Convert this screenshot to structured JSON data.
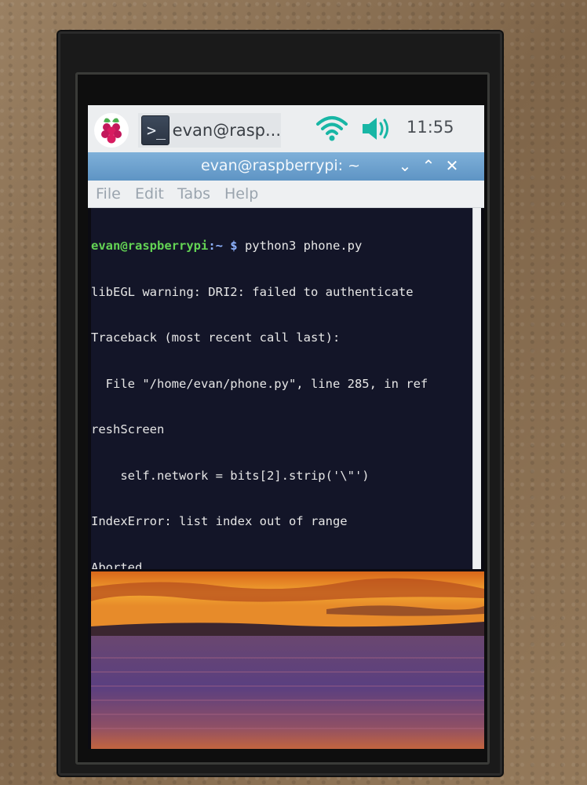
{
  "panel": {
    "task_title": "evan@rasp...",
    "clock": "11:55",
    "menu_icon": "raspberry-pi-logo",
    "network_icon": "wifi-icon",
    "volume_icon": "speaker-icon"
  },
  "window": {
    "title": "evan@raspberrypi: ~",
    "controls": [
      "minimize",
      "maximize",
      "close"
    ]
  },
  "menubar": {
    "file": "File",
    "edit": "Edit",
    "tabs": "Tabs",
    "help": "Help"
  },
  "terminal": {
    "prompt_user": "evan@raspberrypi",
    "prompt_path": ":~ $",
    "command": " python3 phone.py",
    "lines": [
      "libEGL warning: DRI2: failed to authenticate",
      "Traceback (most recent call last):",
      "  File \"/home/evan/phone.py\", line 285, in ref",
      "reshScreen",
      "    self.network = bits[2].strip('\\\"')",
      "IndexError: list index out of range",
      "Aborted"
    ]
  },
  "colors": {
    "titlebar": "#6fa3d0",
    "terminal_bg": "#131528",
    "prompt_user": "#63d354",
    "prompt_path": "#8fb3ff",
    "panel_bg": "#eceef0"
  }
}
